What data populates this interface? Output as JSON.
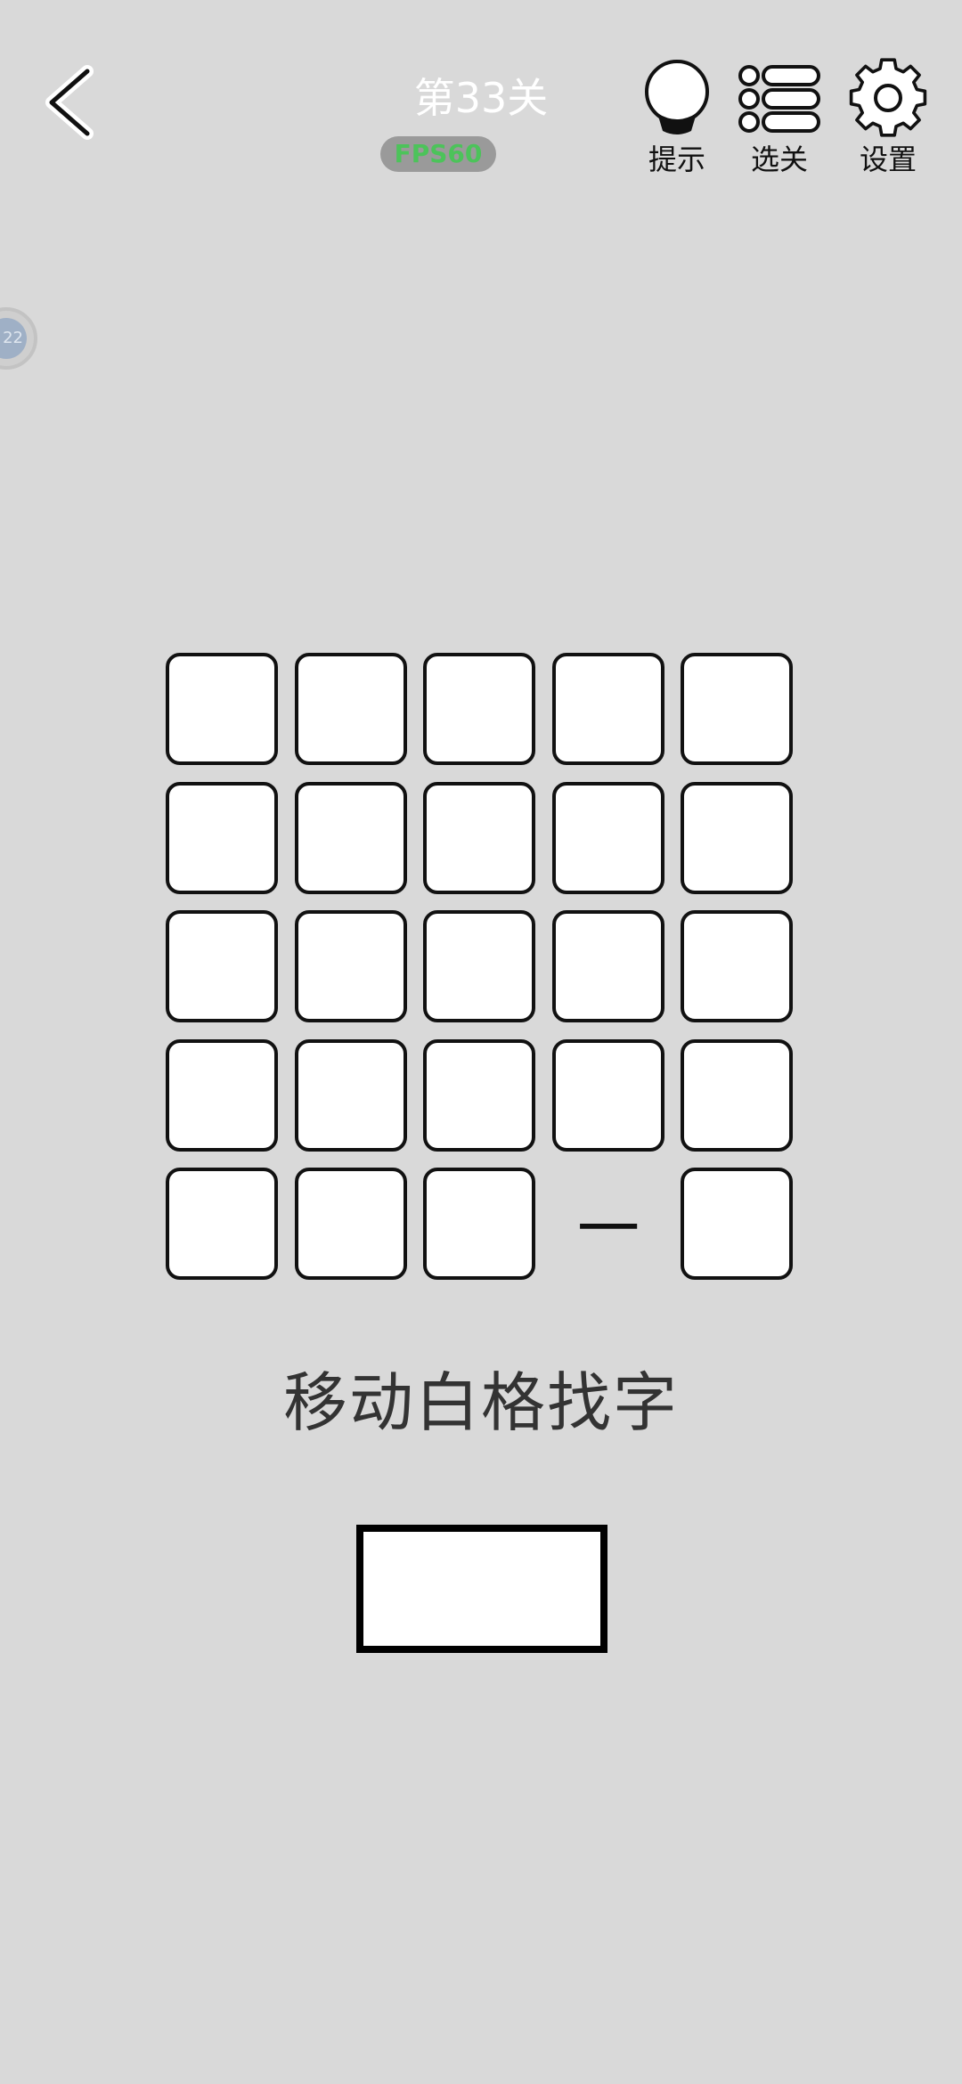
{
  "header": {
    "level_title": "第33关",
    "fps_label": "FPS60",
    "hint_label": "提示",
    "levels_label": "选关",
    "settings_label": "设置"
  },
  "float_button": {
    "label": "22"
  },
  "puzzle": {
    "rows": 5,
    "cols": 5,
    "tiles": [
      {
        "row": 0,
        "col": 0,
        "char": "",
        "state": "covered"
      },
      {
        "row": 0,
        "col": 1,
        "char": "",
        "state": "covered"
      },
      {
        "row": 0,
        "col": 2,
        "char": "",
        "state": "covered"
      },
      {
        "row": 0,
        "col": 3,
        "char": "",
        "state": "covered"
      },
      {
        "row": 0,
        "col": 4,
        "char": "",
        "state": "covered"
      },
      {
        "row": 1,
        "col": 0,
        "char": "",
        "state": "covered"
      },
      {
        "row": 1,
        "col": 1,
        "char": "",
        "state": "covered"
      },
      {
        "row": 1,
        "col": 2,
        "char": "",
        "state": "covered"
      },
      {
        "row": 1,
        "col": 3,
        "char": "",
        "state": "covered"
      },
      {
        "row": 1,
        "col": 4,
        "char": "",
        "state": "covered"
      },
      {
        "row": 2,
        "col": 0,
        "char": "",
        "state": "covered"
      },
      {
        "row": 2,
        "col": 1,
        "char": "",
        "state": "covered"
      },
      {
        "row": 2,
        "col": 2,
        "char": "",
        "state": "covered"
      },
      {
        "row": 2,
        "col": 3,
        "char": "",
        "state": "covered"
      },
      {
        "row": 2,
        "col": 4,
        "char": "",
        "state": "covered"
      },
      {
        "row": 3,
        "col": 0,
        "char": "",
        "state": "covered"
      },
      {
        "row": 3,
        "col": 1,
        "char": "",
        "state": "covered"
      },
      {
        "row": 3,
        "col": 2,
        "char": "",
        "state": "covered"
      },
      {
        "row": 3,
        "col": 3,
        "char": "",
        "state": "covered"
      },
      {
        "row": 3,
        "col": 4,
        "char": "",
        "state": "covered"
      },
      {
        "row": 4,
        "col": 0,
        "char": "",
        "state": "covered"
      },
      {
        "row": 4,
        "col": 1,
        "char": "",
        "state": "covered"
      },
      {
        "row": 4,
        "col": 2,
        "char": "",
        "state": "covered"
      },
      {
        "row": 4,
        "col": 3,
        "char": "一",
        "state": "revealed"
      },
      {
        "row": 4,
        "col": 4,
        "char": "",
        "state": "covered"
      }
    ]
  },
  "instruction": "移动白格找字",
  "answer_box": {
    "value": ""
  },
  "icons": {
    "back": "chevron-left-icon",
    "hint": "lightbulb-icon",
    "levels": "list-icon",
    "settings": "gear-icon"
  },
  "colors": {
    "background": "#d9d9d9",
    "tile_fill": "#ffffff",
    "tile_border": "#111111",
    "fps_text": "#4cc35a",
    "title_text": "#ffffff"
  }
}
